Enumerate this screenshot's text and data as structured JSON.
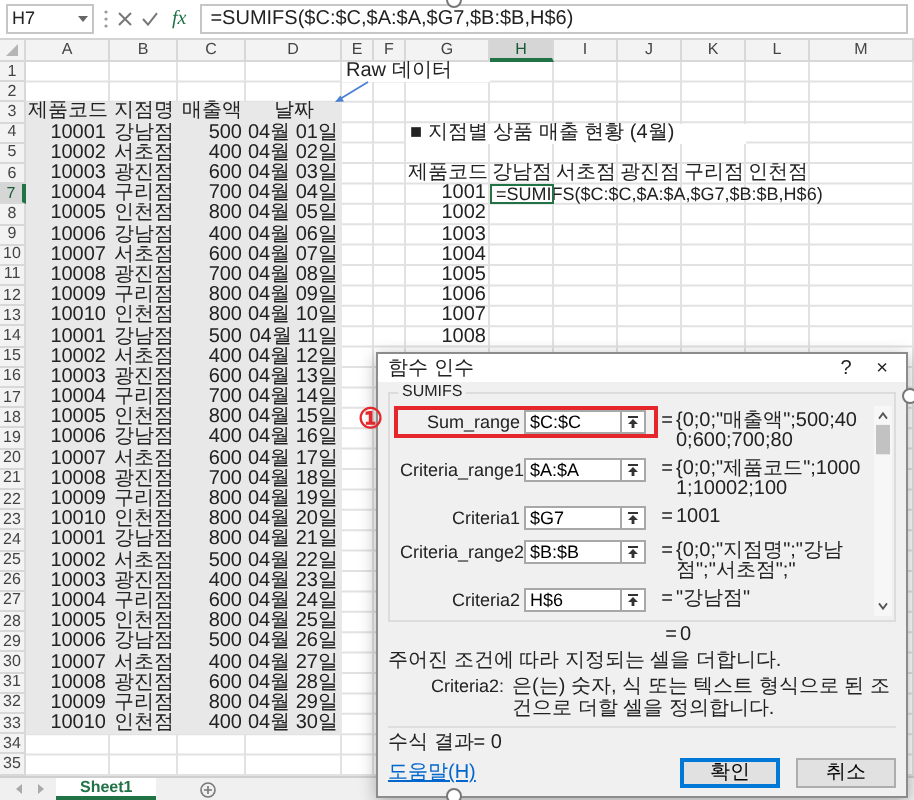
{
  "formula_bar": {
    "name_box": "H7",
    "function_label": "fx",
    "formula": "=SUMIFS($C:$C,$A:$A,$G7,$B:$B,H$6)"
  },
  "columns": [
    {
      "label": "A",
      "selected": false
    },
    {
      "label": "B",
      "selected": false
    },
    {
      "label": "C",
      "selected": false
    },
    {
      "label": "D",
      "selected": false
    },
    {
      "label": "E",
      "selected": false
    },
    {
      "label": "F",
      "selected": false
    },
    {
      "label": "G",
      "selected": false
    },
    {
      "label": "H",
      "selected": true
    },
    {
      "label": "I",
      "selected": false
    },
    {
      "label": "J",
      "selected": false
    },
    {
      "label": "K",
      "selected": false
    },
    {
      "label": "L",
      "selected": false
    },
    {
      "label": "M",
      "selected": false
    }
  ],
  "row_numbers": [
    {
      "label": "1",
      "selected": false
    },
    {
      "label": "2",
      "selected": false
    },
    {
      "label": "3",
      "selected": false
    },
    {
      "label": "4",
      "selected": false
    },
    {
      "label": "5",
      "selected": false
    },
    {
      "label": "6",
      "selected": false
    },
    {
      "label": "7",
      "selected": true
    },
    {
      "label": "8",
      "selected": false
    },
    {
      "label": "9",
      "selected": false
    },
    {
      "label": "10",
      "selected": false
    },
    {
      "label": "11",
      "selected": false
    },
    {
      "label": "12",
      "selected": false
    },
    {
      "label": "13",
      "selected": false
    },
    {
      "label": "14",
      "selected": false
    },
    {
      "label": "15",
      "selected": false
    },
    {
      "label": "16",
      "selected": false
    },
    {
      "label": "17",
      "selected": false
    },
    {
      "label": "18",
      "selected": false
    },
    {
      "label": "19",
      "selected": false
    },
    {
      "label": "20",
      "selected": false
    },
    {
      "label": "21",
      "selected": false
    },
    {
      "label": "22",
      "selected": false
    },
    {
      "label": "23",
      "selected": false
    },
    {
      "label": "24",
      "selected": false
    },
    {
      "label": "25",
      "selected": false
    },
    {
      "label": "26",
      "selected": false
    },
    {
      "label": "27",
      "selected": false
    },
    {
      "label": "28",
      "selected": false
    },
    {
      "label": "29",
      "selected": false
    },
    {
      "label": "30",
      "selected": false
    },
    {
      "label": "31",
      "selected": false
    },
    {
      "label": "32",
      "selected": false
    },
    {
      "label": "33",
      "selected": false
    },
    {
      "label": "34",
      "selected": false
    },
    {
      "label": "35",
      "selected": false
    }
  ],
  "note": "Raw 데이터",
  "raw_data": {
    "header": [
      "제품코드",
      "지점명",
      "매출액",
      "날짜"
    ],
    "rows": [
      {
        "code": "10001",
        "branch": "강남점",
        "sales": "500",
        "date": "04월 01일"
      },
      {
        "code": "10002",
        "branch": "서초점",
        "sales": "400",
        "date": "04월 02일"
      },
      {
        "code": "10003",
        "branch": "광진점",
        "sales": "600",
        "date": "04월 03일"
      },
      {
        "code": "10004",
        "branch": "구리점",
        "sales": "700",
        "date": "04월 04일"
      },
      {
        "code": "10005",
        "branch": "인천점",
        "sales": "800",
        "date": "04월 05일"
      },
      {
        "code": "10006",
        "branch": "강남점",
        "sales": "400",
        "date": "04월 06일"
      },
      {
        "code": "10007",
        "branch": "서초점",
        "sales": "600",
        "date": "04월 07일"
      },
      {
        "code": "10008",
        "branch": "광진점",
        "sales": "700",
        "date": "04월 08일"
      },
      {
        "code": "10009",
        "branch": "구리점",
        "sales": "800",
        "date": "04월 09일"
      },
      {
        "code": "10010",
        "branch": "인천점",
        "sales": "800",
        "date": "04월 10일"
      },
      {
        "code": "10001",
        "branch": "강남점",
        "sales": "500",
        "date": "04월 11일"
      },
      {
        "code": "10002",
        "branch": "서초점",
        "sales": "400",
        "date": "04월 12일"
      },
      {
        "code": "10003",
        "branch": "광진점",
        "sales": "600",
        "date": "04월 13일"
      },
      {
        "code": "10004",
        "branch": "구리점",
        "sales": "700",
        "date": "04월 14일"
      },
      {
        "code": "10005",
        "branch": "인천점",
        "sales": "800",
        "date": "04월 15일"
      },
      {
        "code": "10006",
        "branch": "강남점",
        "sales": "400",
        "date": "04월 16일"
      },
      {
        "code": "10007",
        "branch": "서초점",
        "sales": "600",
        "date": "04월 17일"
      },
      {
        "code": "10008",
        "branch": "광진점",
        "sales": "700",
        "date": "04월 18일"
      },
      {
        "code": "10009",
        "branch": "구리점",
        "sales": "800",
        "date": "04월 19일"
      },
      {
        "code": "10010",
        "branch": "인천점",
        "sales": "800",
        "date": "04월 20일"
      },
      {
        "code": "10001",
        "branch": "강남점",
        "sales": "800",
        "date": "04월 21일"
      },
      {
        "code": "10002",
        "branch": "서초점",
        "sales": "500",
        "date": "04월 22일"
      },
      {
        "code": "10003",
        "branch": "광진점",
        "sales": "400",
        "date": "04월 23일"
      },
      {
        "code": "10004",
        "branch": "구리점",
        "sales": "600",
        "date": "04월 24일"
      },
      {
        "code": "10005",
        "branch": "인천점",
        "sales": "800",
        "date": "04월 25일"
      },
      {
        "code": "10006",
        "branch": "강남점",
        "sales": "500",
        "date": "04월 26일"
      },
      {
        "code": "10007",
        "branch": "서초점",
        "sales": "400",
        "date": "04월 27일"
      },
      {
        "code": "10008",
        "branch": "광진점",
        "sales": "600",
        "date": "04월 28일"
      },
      {
        "code": "10009",
        "branch": "구리점",
        "sales": "800",
        "date": "04월 29일"
      },
      {
        "code": "10010",
        "branch": "인천점",
        "sales": "400",
        "date": "04월 30일"
      }
    ]
  },
  "summary": {
    "title": "■ 지점별 상품 매출 현황 (4월)",
    "header": [
      "제품코드",
      "강남점",
      "서초점",
      "광진점",
      "구리점",
      "인천점"
    ],
    "codes": [
      "1001",
      "1002",
      "1003",
      "1004",
      "1005",
      "1006",
      "1007",
      "1008"
    ],
    "cell_formula": "=SUMIFS($C:$C,$A:$A,$G7,$B:$B,H$6)"
  },
  "dialog": {
    "title": "함수 인수",
    "help_button": "?",
    "close_button": "×",
    "function_name": "SUMIFS",
    "marker": "①",
    "arguments": [
      {
        "label": "Sum_range",
        "value": "$C:$C",
        "equals": "=",
        "result": "{0;0;\"매출액\";500;400;600;700;80",
        "highlighted": true
      },
      {
        "label": "Criteria_range1",
        "value": "$A:$A",
        "equals": "=",
        "result": "{0;0;\"제품코드\";10001;10002;100",
        "highlighted": false
      },
      {
        "label": "Criteria1",
        "value": "$G7",
        "equals": "=",
        "result": "1001",
        "highlighted": false
      },
      {
        "label": "Criteria_range2",
        "value": "$B:$B",
        "equals": "=",
        "result": "{0;0;\"지점명\";\"강남점\";\"서초점\";\"",
        "highlighted": false
      },
      {
        "label": "Criteria2",
        "value": "H$6",
        "equals": "=",
        "result": "\"강남점\"",
        "highlighted": false
      }
    ],
    "total": {
      "equals": "=",
      "value": "0"
    },
    "description": "주어진 조건에 따라 지정되는 셀을 더합니다.",
    "detail_label": "Criteria2:",
    "detail": "은(는) 숫자, 식 또는 텍스트 형식으로 된 조건으로 더할 셀을 정의합니다.",
    "formula_result": "수식 결과= 0",
    "help_link": "도움말(H)",
    "buttons": [
      {
        "label": "확인",
        "default": true
      },
      {
        "label": "취소",
        "default": false
      }
    ]
  },
  "sheet_tabs": [
    {
      "label": "Sheet1",
      "selected": true
    }
  ]
}
